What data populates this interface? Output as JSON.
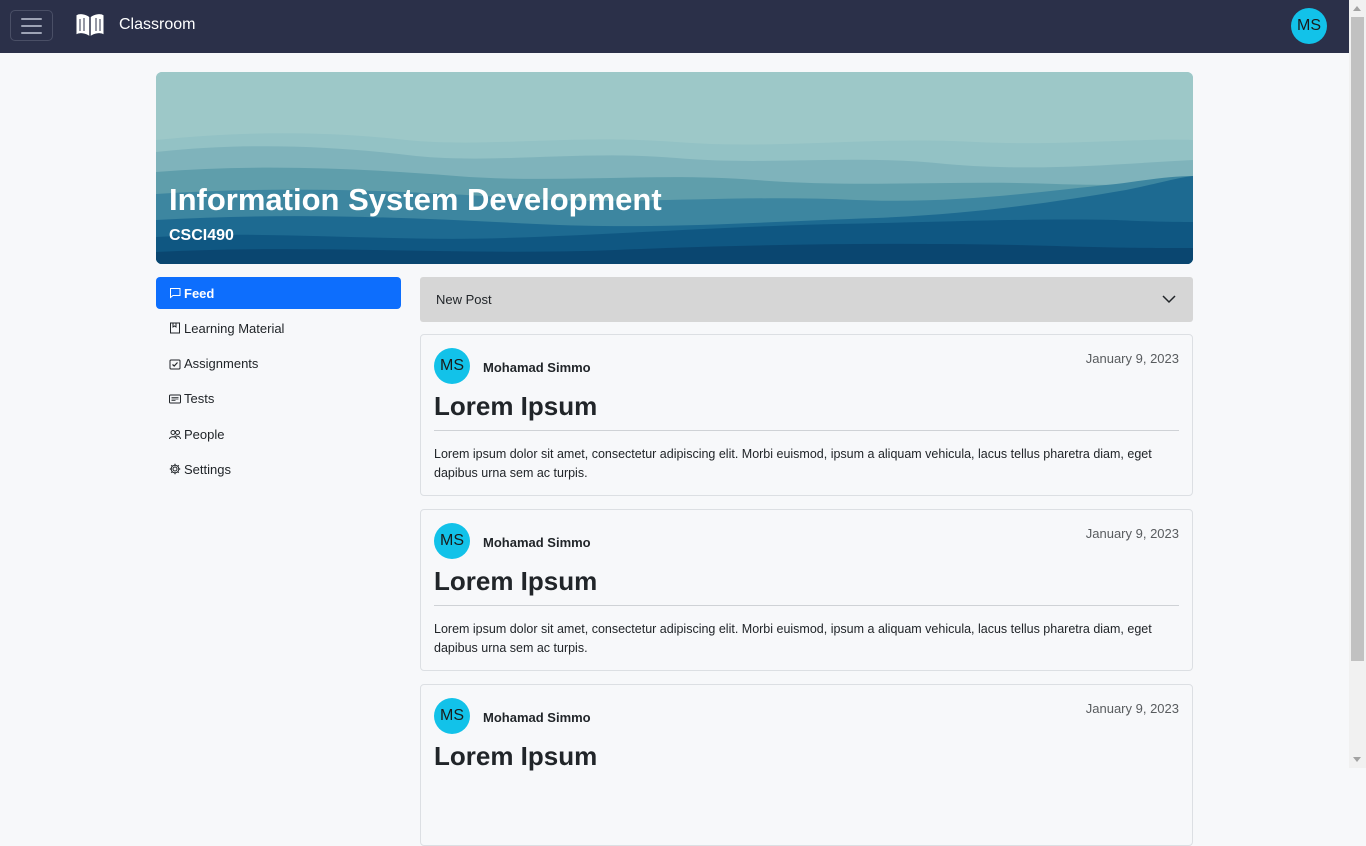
{
  "app": {
    "brand": "Classroom",
    "user_initials": "MS"
  },
  "course": {
    "title": "Information System Development",
    "code": "CSCI490"
  },
  "sidebar": {
    "items": [
      {
        "label": "Feed",
        "icon": "chat-square-icon",
        "active": true
      },
      {
        "label": "Learning Material",
        "icon": "journal-icon",
        "active": false
      },
      {
        "label": "Assignments",
        "icon": "calendar-check-icon",
        "active": false
      },
      {
        "label": "Tests",
        "icon": "card-text-icon",
        "active": false
      },
      {
        "label": "People",
        "icon": "people-icon",
        "active": false
      },
      {
        "label": "Settings",
        "icon": "gear-icon",
        "active": false
      }
    ]
  },
  "new_post": {
    "label": "New Post"
  },
  "posts": [
    {
      "initials": "MS",
      "author": "Mohamad Simmo",
      "date": "January 9, 2023",
      "title": "Lorem Ipsum",
      "body": "Lorem ipsum dolor sit amet, consectetur adipiscing elit. Morbi euismod, ipsum a aliquam vehicula, lacus tellus pharetra diam, eget dapibus urna sem ac turpis."
    },
    {
      "initials": "MS",
      "author": "Mohamad Simmo",
      "date": "January 9, 2023",
      "title": "Lorem Ipsum",
      "body": "Lorem ipsum dolor sit amet, consectetur adipiscing elit. Morbi euismod, ipsum a aliquam vehicula, lacus tellus pharetra diam, eget dapibus urna sem ac turpis."
    },
    {
      "initials": "MS",
      "author": "Mohamad Simmo",
      "date": "January 9, 2023",
      "title": "Lorem Ipsum",
      "body": ""
    }
  ],
  "colors": {
    "navbar": "#2b3049",
    "accent": "#0d6efd",
    "avatar": "#12c2e9"
  }
}
